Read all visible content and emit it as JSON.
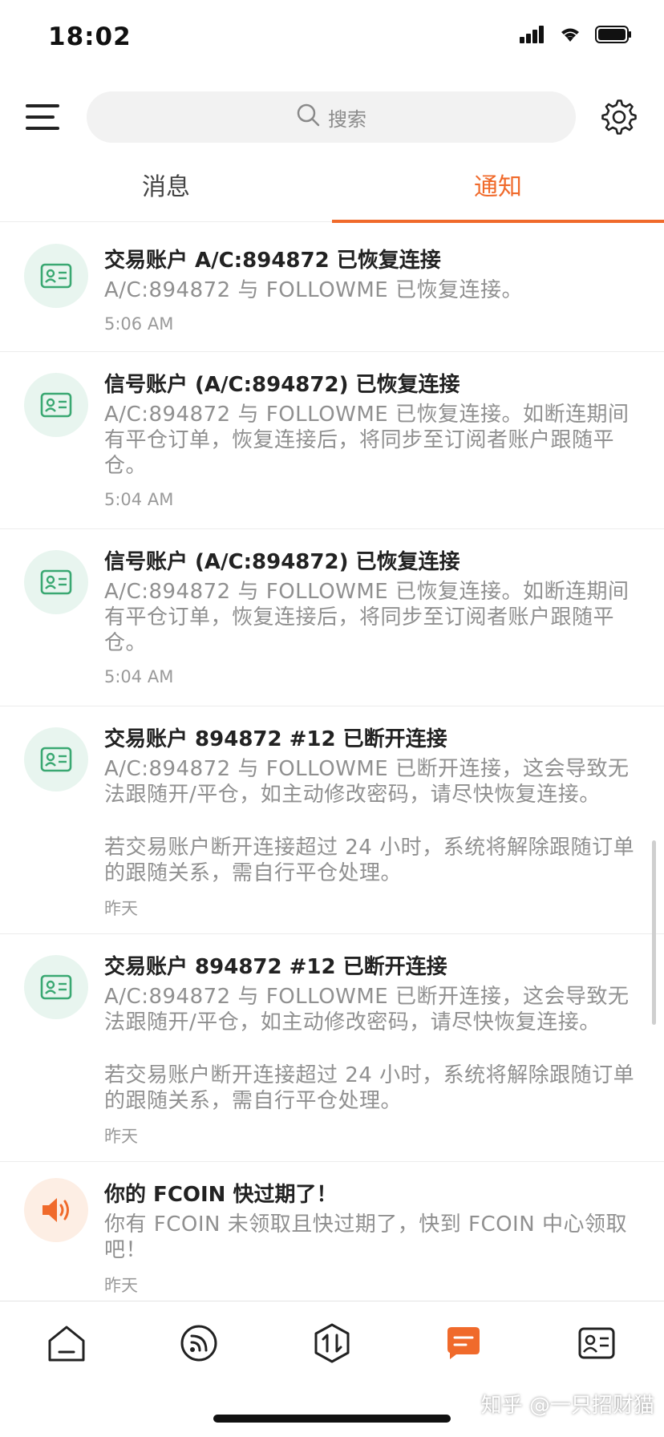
{
  "status_bar": {
    "time": "18:02"
  },
  "header": {
    "search_placeholder": "搜索"
  },
  "tabs": [
    {
      "label": "消息",
      "active": false
    },
    {
      "label": "通知",
      "active": true
    }
  ],
  "accent_color": "#f06a2b",
  "notifications": [
    {
      "icon": "account-card-icon",
      "title": "交易账户 A/C:894872 已恢复连接",
      "body": "A/C:894872 与 FOLLOWME 已恢复连接。",
      "time": "5:06 AM"
    },
    {
      "icon": "account-card-icon",
      "title": "信号账户 (A/C:894872) 已恢复连接",
      "body": "A/C:894872 与 FOLLOWME 已恢复连接。如断连期间有平仓订单，恢复连接后，将同步至订阅者账户跟随平仓。",
      "time": "5:04 AM"
    },
    {
      "icon": "account-card-icon",
      "title": "信号账户 (A/C:894872) 已恢复连接",
      "body": "A/C:894872 与 FOLLOWME 已恢复连接。如断连期间有平仓订单，恢复连接后，将同步至订阅者账户跟随平仓。",
      "time": "5:04 AM"
    },
    {
      "icon": "account-card-icon",
      "title": "交易账户 894872 #12 已断开连接",
      "body": "A/C:894872 与 FOLLOWME 已断开连接，这会导致无法跟随开/平仓，如主动修改密码，请尽快恢复连接。",
      "body2": "若交易账户断开连接超过 24 小时，系统将解除跟随订单的跟随关系，需自行平仓处理。",
      "time": "昨天"
    },
    {
      "icon": "account-card-icon",
      "title": "交易账户 894872 #12 已断开连接",
      "body": "A/C:894872 与 FOLLOWME 已断开连接，这会导致无法跟随开/平仓，如主动修改密码，请尽快恢复连接。",
      "body2": "若交易账户断开连接超过 24 小时，系统将解除跟随订单的跟随关系，需自行平仓处理。",
      "time": "昨天"
    },
    {
      "icon": "speaker-icon",
      "title": "你的 FCOIN 快过期了！",
      "body": "你有 FCOIN 未领取且快过期了，快到 FCOIN 中心领取吧！",
      "time": "昨天"
    }
  ],
  "bottom_nav": [
    {
      "icon": "home-icon",
      "active": false
    },
    {
      "icon": "feed-icon",
      "active": false
    },
    {
      "icon": "trade-icon",
      "active": false
    },
    {
      "icon": "message-icon",
      "active": true
    },
    {
      "icon": "profile-card-icon",
      "active": false
    }
  ],
  "watermark": "知乎 @一只招财猫"
}
